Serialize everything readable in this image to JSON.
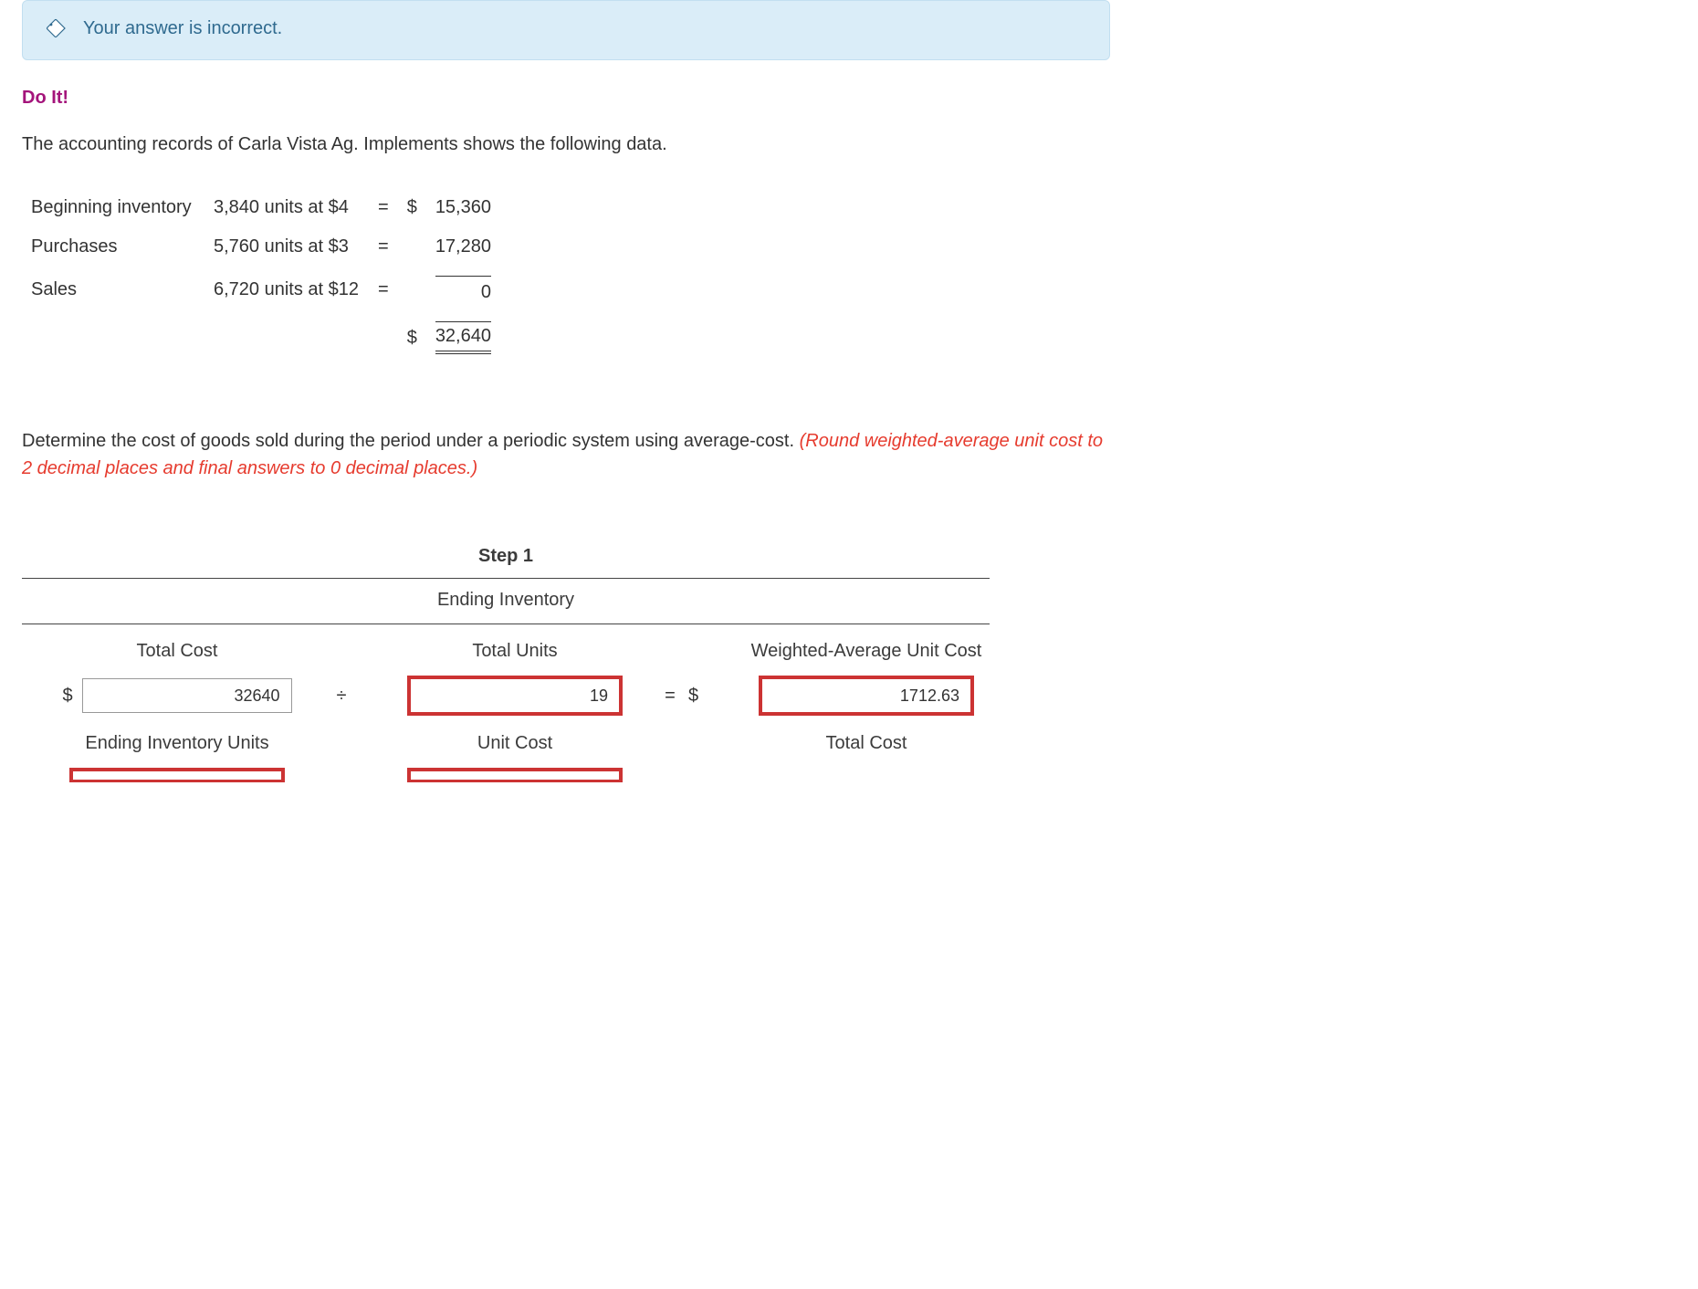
{
  "alert": {
    "message": "Your answer is incorrect."
  },
  "heading": "Do It!",
  "intro": "The accounting records of Carla Vista Ag. Implements shows the following data.",
  "ledger": {
    "rows": [
      {
        "label": "Beginning inventory",
        "units": "3,840 units at $4",
        "dollar": "$",
        "amount": "15,360"
      },
      {
        "label": "Purchases",
        "units": "5,760 units at $3",
        "dollar": "",
        "amount": "17,280"
      },
      {
        "label": "Sales",
        "units": "6,720 units at $12",
        "dollar": "",
        "amount": "0"
      }
    ],
    "total_dollar": "$",
    "total_amount": "32,640"
  },
  "instruction": {
    "main": "Determine the cost of goods sold during the period under a periodic system using average-cost. ",
    "note": "(Round weighted-average unit cost to 2 decimal places and final answers to 0 decimal places.)"
  },
  "step": {
    "title": "Step 1",
    "subtitle": "Ending Inventory",
    "cols": [
      "Total Cost",
      "Total Units",
      "Weighted-Average Unit Cost"
    ],
    "divide": "÷",
    "equals": "=",
    "dollar": "$",
    "values": {
      "total_cost": "32640",
      "total_units": "19",
      "wauc": "1712.63"
    },
    "row2_labels": [
      "Ending Inventory Units",
      "Unit Cost",
      "Total Cost"
    ]
  }
}
